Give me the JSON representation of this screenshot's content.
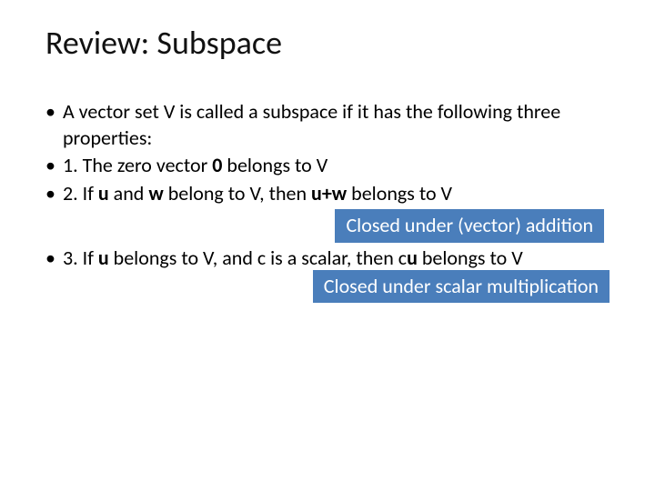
{
  "title": "Review: Subspace",
  "bullets": {
    "intro": "A vector set V is called a subspace if it has the following three properties:",
    "item1_pre": "1. The zero vector ",
    "item1_bold": "0",
    "item1_post": " belongs to V",
    "item2_pre": "2. If ",
    "item2_u": "u",
    "item2_mid1": " and ",
    "item2_w": "w",
    "item2_mid2": " belong to V, then ",
    "item2_uw": "u+w",
    "item2_post": " belongs to V",
    "item3_pre": "3. If ",
    "item3_u": "u",
    "item3_mid": " belongs to V, and c is a scalar, then c",
    "item3_u2": "u",
    "item3_post": " belongs to V"
  },
  "callouts": {
    "addition": "Closed under (vector) addition",
    "scalar": "Closed under scalar multiplication"
  }
}
